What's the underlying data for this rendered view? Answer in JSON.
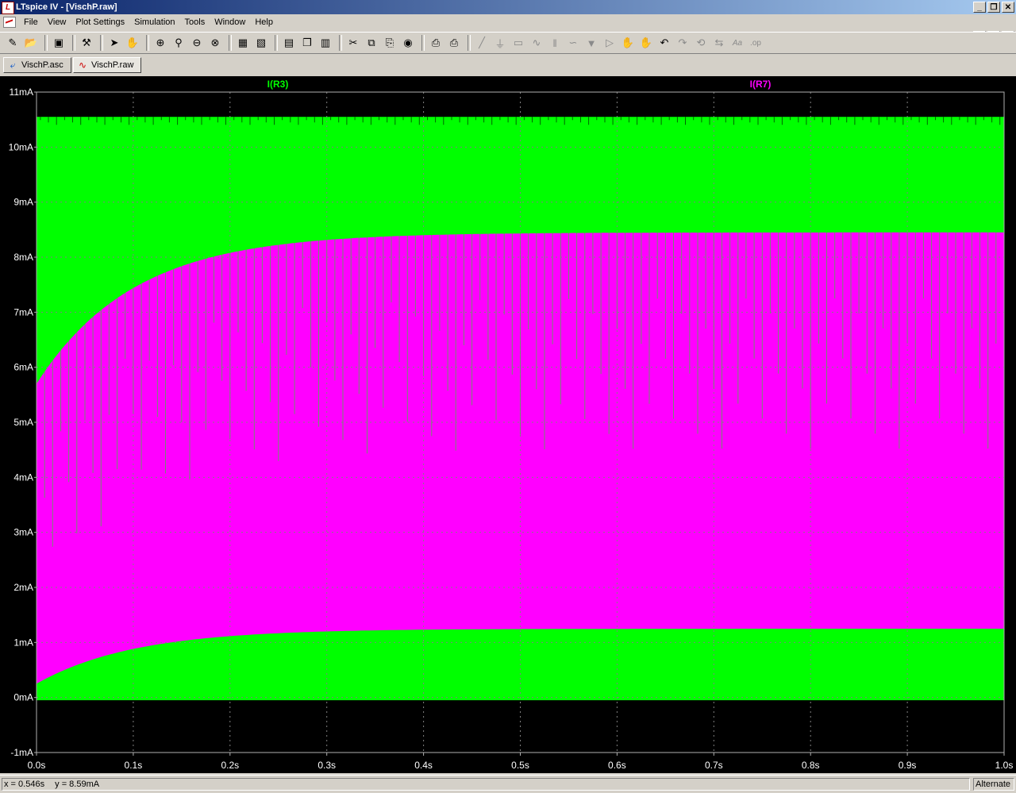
{
  "window": {
    "title": "LTspice IV - [VischP.raw]",
    "controls": [
      "_",
      "❐",
      "✕"
    ]
  },
  "menu": {
    "items": [
      "File",
      "View",
      "Plot Settings",
      "Simulation",
      "Tools",
      "Window",
      "Help"
    ]
  },
  "toolbar": {
    "icons": [
      "new-schematic-icon",
      "open-icon",
      "save-icon",
      "control-panel-icon",
      "run-icon",
      "halt-icon",
      "zoom-in-icon",
      "zoom-area-icon",
      "zoom-out-icon",
      "zoom-cancel-icon",
      "autorange-icon",
      "mark-icon",
      "tile-horizontal-icon",
      "cascade-icon",
      "tile-vertical-icon",
      "cut-icon",
      "copy-icon",
      "paste-icon",
      "find-icon",
      "print-setup-icon",
      "print-icon",
      "wire-icon",
      "ground-icon",
      "label-icon",
      "resistor-icon",
      "capacitor-icon",
      "inductor-icon",
      "diode-icon",
      "component-icon",
      "move-icon",
      "drag-icon",
      "undo-icon",
      "redo-icon",
      "rotate-icon",
      "mirror-icon",
      "text-icon",
      "spice-directive-icon"
    ]
  },
  "tabs": [
    {
      "label": "VischP.asc",
      "icon": "schematic-icon",
      "active": false
    },
    {
      "label": "VischP.raw",
      "icon": "waveform-icon",
      "active": true
    }
  ],
  "chart_data": {
    "type": "area",
    "background": "#000000",
    "grid": true,
    "grid_color": "#808080",
    "x": {
      "label": "",
      "unit": "s",
      "min": 0,
      "max": 1.0,
      "ticks": [
        "0.0s",
        "0.1s",
        "0.2s",
        "0.3s",
        "0.4s",
        "0.5s",
        "0.6s",
        "0.7s",
        "0.8s",
        "0.9s",
        "1.0s"
      ]
    },
    "y": {
      "label": "",
      "unit": "mA",
      "min": -1,
      "max": 11,
      "ticks": [
        "-1mA",
        "0mA",
        "1mA",
        "2mA",
        "3mA",
        "4mA",
        "5mA",
        "6mA",
        "7mA",
        "8mA",
        "9mA",
        "10mA",
        "11mA"
      ]
    },
    "series": [
      {
        "name": "I(R3)",
        "color": "#00ff00",
        "upper": 10.55,
        "lower": -0.05,
        "time_constant": 0.1
      },
      {
        "name": "I(R7)",
        "color": "#ff00ff",
        "upper_start": 5.7,
        "upper_end": 8.45,
        "lower_start": 0.25,
        "lower_end": 1.25,
        "time_constant": 0.1
      }
    ]
  },
  "status": {
    "x": "x = 0.546s",
    "y": "y = 8.59mA",
    "mode": "Alternate"
  }
}
